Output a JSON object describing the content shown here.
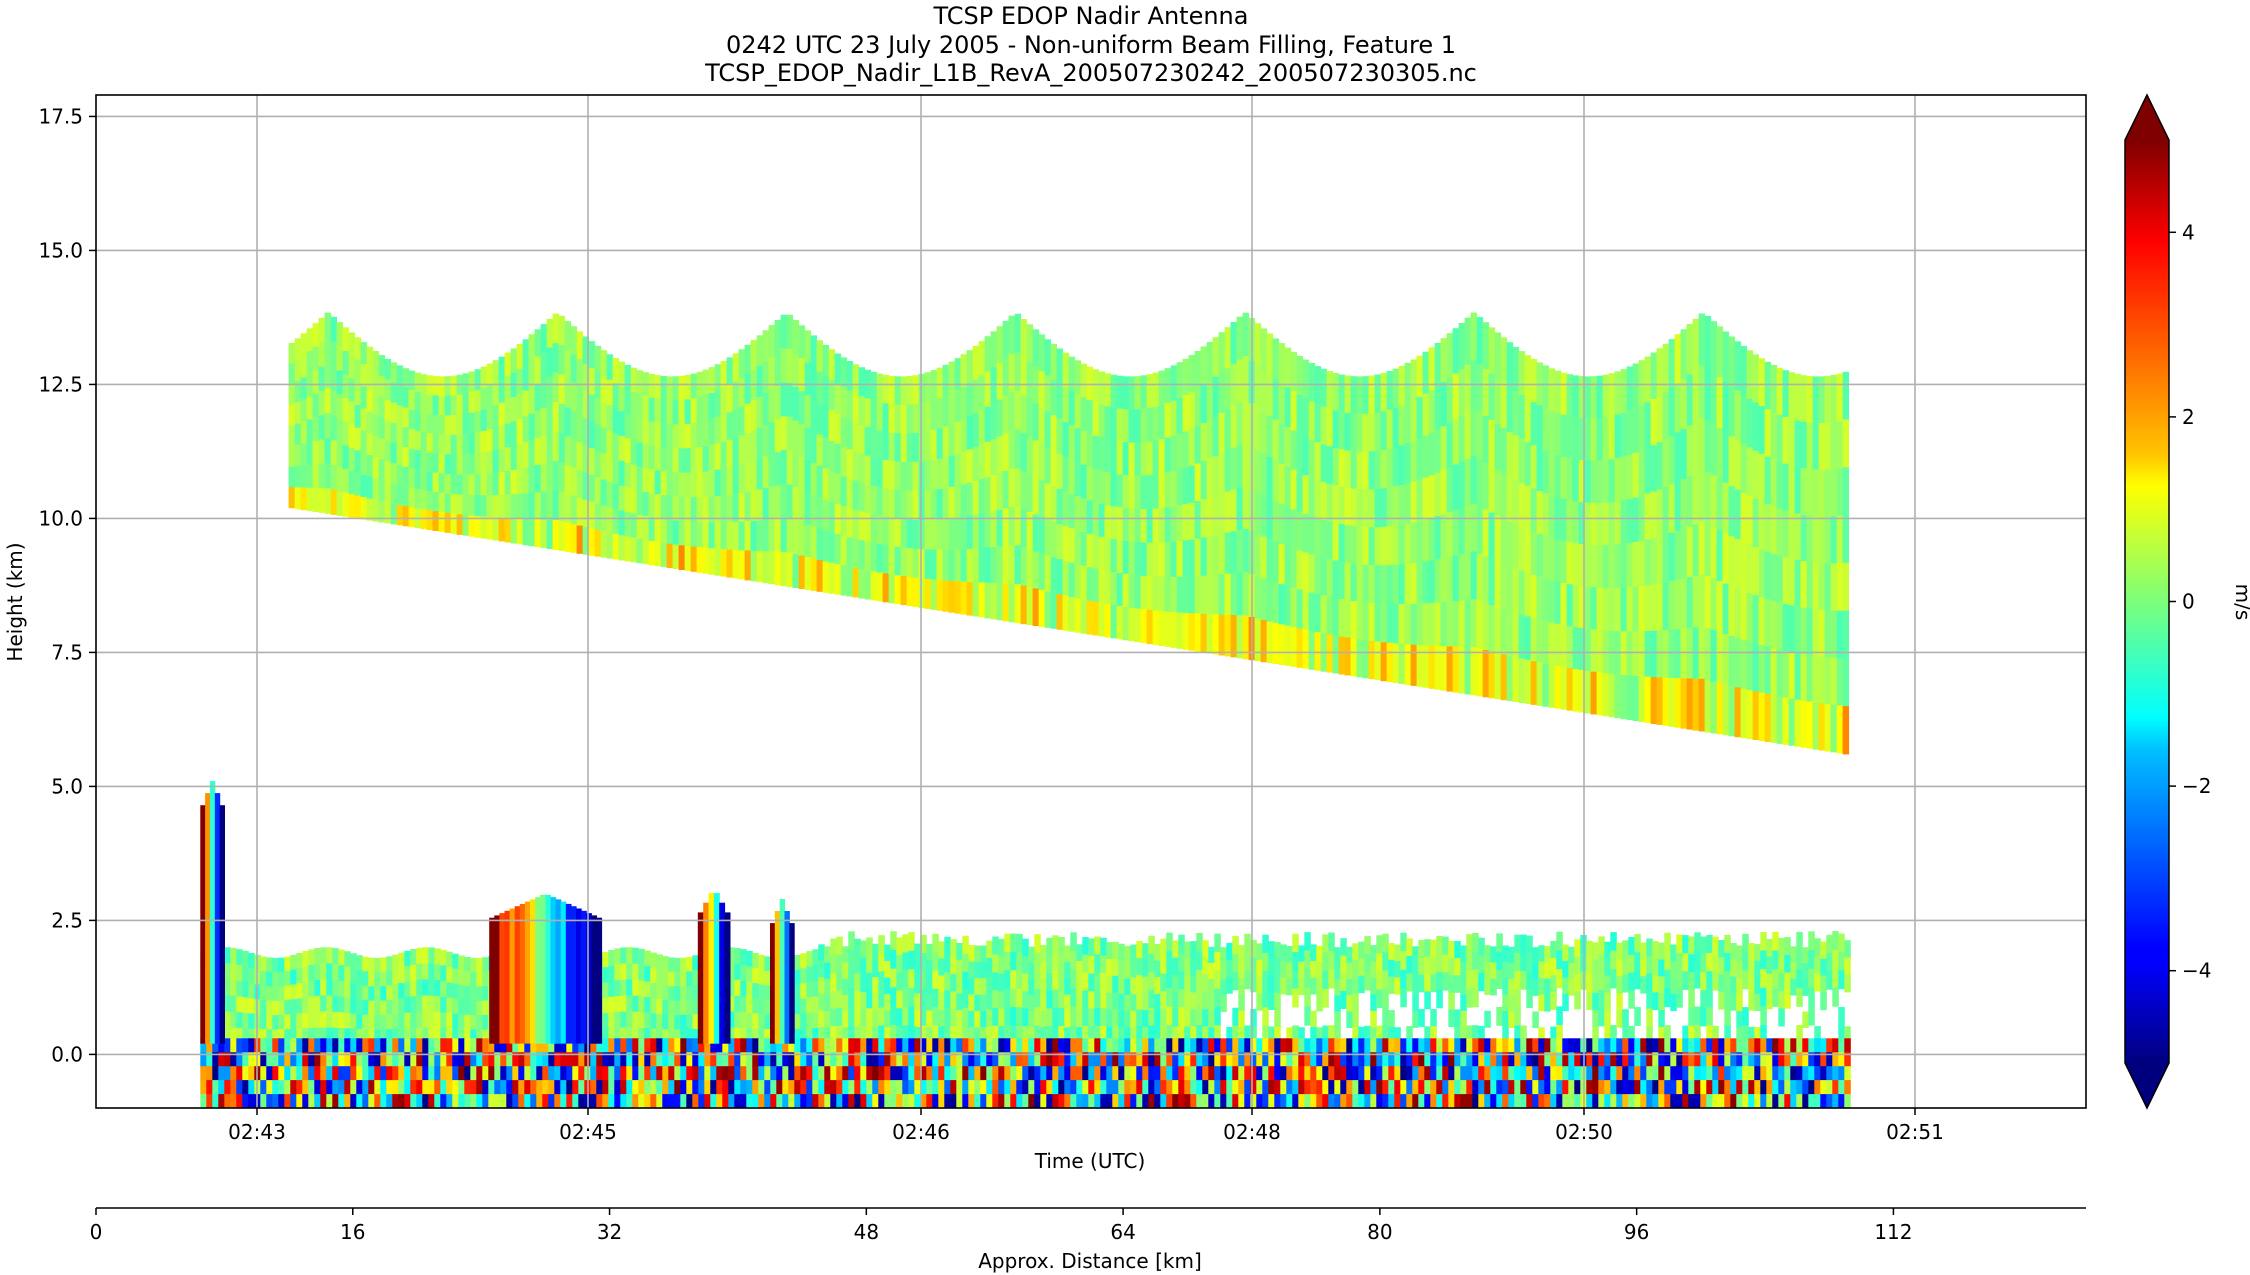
{
  "chart_data": {
    "type": "heatmap",
    "title_lines": [
      "TCSP EDOP Nadir Antenna",
      "0242 UTC 23 July 2005 - Non-uniform Beam Filling, Feature 1",
      "TCSP_EDOP_Nadir_L1B_RevA_200507230242_200507230305.nc"
    ],
    "xlabel": "Time (UTC)",
    "ylabel": "Height (km)",
    "x_ticks": [
      "02:43",
      "02:45",
      "02:46",
      "02:48",
      "02:50",
      "02:51"
    ],
    "y_ticks": [
      "0.0",
      "2.5",
      "5.0",
      "7.5",
      "10.0",
      "12.5",
      "15.0",
      "17.5"
    ],
    "ylim": [
      -1.0,
      17.9
    ],
    "grid": true,
    "secondary_xaxis": {
      "label": "Approx. Distance [km]",
      "ticks": [
        "0",
        "16",
        "32",
        "48",
        "64",
        "80",
        "96",
        "112"
      ],
      "range": [
        0,
        124
      ]
    },
    "colorbar": {
      "label": "m/s",
      "ticks": [
        "−4",
        "−2",
        "0",
        "2",
        "4"
      ],
      "range": [
        -5,
        5
      ],
      "colormap": "jet",
      "extend": "both"
    },
    "features": [
      {
        "name": "upper cloud layer",
        "km_start": 12,
        "km_end": 109,
        "top_height": 13.7,
        "base_height_start": 10.2,
        "base_height_end": 5.6,
        "velocity": 0.2
      },
      {
        "name": "low cloud layer",
        "km_start": 6.5,
        "km_end": 109,
        "top_height": 2.3,
        "base_height": 0.2,
        "velocity": 0.0
      },
      {
        "name": "convective cell 1",
        "km_start": 6.5,
        "km_end": 8.0,
        "top_height": 5.1,
        "velocity_range": [
          -5,
          5
        ]
      },
      {
        "name": "convective cell 2",
        "km_start": 24.5,
        "km_end": 31.5,
        "top_height": 3.0,
        "velocity_range": [
          -5,
          5
        ]
      },
      {
        "name": "convective cell 3",
        "km_start": 37.5,
        "km_end": 39.5,
        "top_height": 3.1,
        "velocity_range": [
          -5,
          5
        ]
      },
      {
        "name": "convective cell 4",
        "km_start": 42.0,
        "km_end": 43.5,
        "top_height": 2.9,
        "velocity_range": [
          -5,
          5
        ]
      },
      {
        "name": "surface return",
        "km_start": 6.5,
        "km_end": 109,
        "height": 0.1,
        "velocity_range": [
          -5,
          5
        ]
      }
    ]
  }
}
